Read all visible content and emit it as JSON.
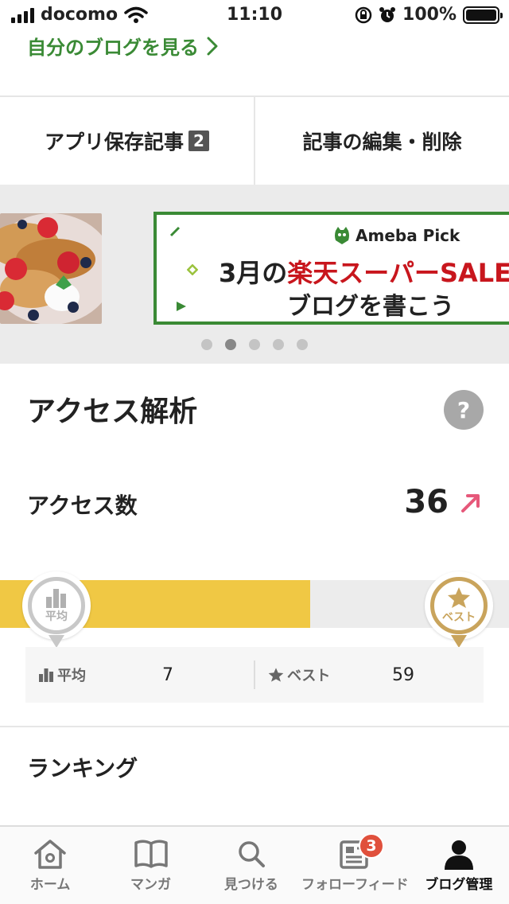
{
  "status_bar": {
    "carrier": "docomo",
    "time": "11:10",
    "battery": "100%"
  },
  "blog_link": {
    "label": "自分のブログを見る"
  },
  "actions": {
    "saved_label": "アプリ保存記事",
    "saved_count": "2",
    "edit_label": "記事の編集・削除"
  },
  "banner": {
    "brand": "Ameba Pick",
    "line1_prefix": "3月の",
    "line1_highlight": "楽天スーパーSALE",
    "line2": "ブログを書こう",
    "active_dot": 1,
    "dot_count": 5
  },
  "analytics": {
    "title": "アクセス解析",
    "help": "?",
    "access_label": "アクセス数",
    "access_value": "36",
    "progress_fraction": 0.61,
    "avg_pin": "平均",
    "best_pin": "ベスト",
    "avg_label": "平均",
    "avg_value": "7",
    "best_label": "ベスト",
    "best_value": "59"
  },
  "ranking": {
    "title": "ランキング"
  },
  "tabbar": {
    "tabs": [
      {
        "label": "ホーム",
        "icon": "home-icon"
      },
      {
        "label": "マンガ",
        "icon": "book-icon"
      },
      {
        "label": "見つける",
        "icon": "search-icon"
      },
      {
        "label": "フォローフィード",
        "icon": "feed-icon",
        "badge": "3"
      },
      {
        "label": "ブログ管理",
        "icon": "person-icon",
        "active": true
      }
    ]
  },
  "colors": {
    "accent_green": "#3a8a35",
    "bar_yellow": "#f0c844",
    "best_gold": "#c9a45c",
    "trend_pink": "#e6587a",
    "badge_red": "#e0503c"
  }
}
